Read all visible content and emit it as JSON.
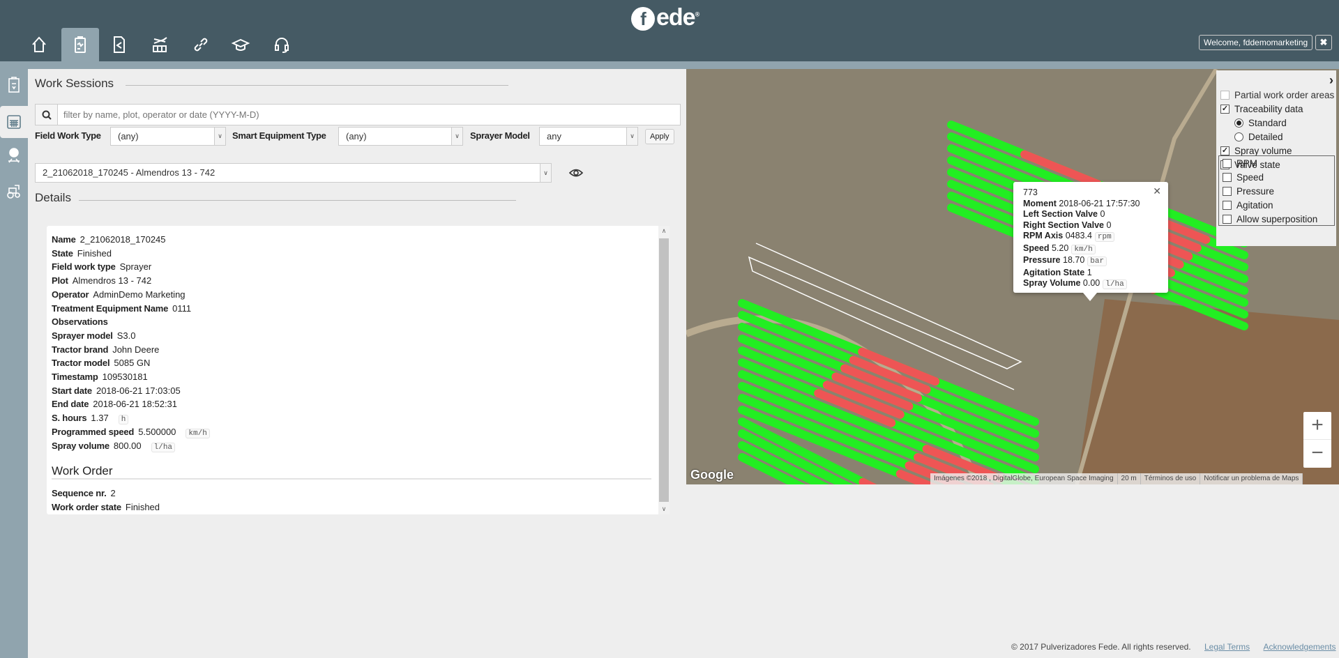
{
  "header": {
    "logo": "fede",
    "welcome": "Welcome, fddemomarketing",
    "logout_icon": "close-icon",
    "nav_icons": [
      "home-icon",
      "clipboard-icon",
      "document-share-icon",
      "sprayer-icon",
      "link-icon",
      "graduation-cap-icon",
      "headset-icon"
    ],
    "active_nav": 1
  },
  "sidebar": {
    "icons": [
      "clipboard-list-icon",
      "calendar-icon",
      "alert-sprayer-icon",
      "tractor-icon"
    ],
    "active": 1
  },
  "work_sessions": {
    "title": "Work Sessions",
    "filter_placeholder": "filter by name, plot, operator or date (YYYY-M-D)",
    "filters": [
      {
        "label": "Field Work Type",
        "value": "(any)"
      },
      {
        "label": "Smart Equipment Type",
        "value": "(any)"
      },
      {
        "label": "Sprayer Model",
        "value": "any"
      }
    ],
    "apply": "Apply",
    "session": "2_21062018_170245 - Almendros 13 - 742"
  },
  "details": {
    "title": "Details",
    "rows": [
      {
        "label": "Name",
        "value": "2_21062018_170245"
      },
      {
        "label": "State",
        "value": "Finished"
      },
      {
        "label": "Field work type",
        "value": "Sprayer"
      },
      {
        "label": "Plot",
        "value": "Almendros 13 - 742"
      },
      {
        "label": "Operator",
        "value": "AdminDemo Marketing"
      },
      {
        "label": "Treatment Equipment Name",
        "value": "0111"
      },
      {
        "label": "Observations",
        "value": ""
      },
      {
        "label": "Sprayer model",
        "value": "S3.0"
      },
      {
        "label": "Tractor brand",
        "value": "John Deere"
      },
      {
        "label": "Tractor model",
        "value": "5085 GN"
      },
      {
        "label": "Timestamp",
        "value": "109530181"
      },
      {
        "label": "Start date",
        "value": "2018-06-21 17:03:05"
      },
      {
        "label": "End date",
        "value": "2018-06-21 18:52:31"
      },
      {
        "label": "S. hours",
        "value": "1.37",
        "unit": "h"
      },
      {
        "label": "Programmed speed",
        "value": "5.500000",
        "unit": "km/h"
      },
      {
        "label": "Spray volume",
        "value": "800.00",
        "unit": "l/ha"
      }
    ],
    "work_order_title": "Work Order",
    "work_order_rows": [
      {
        "label": "Sequence nr.",
        "value": "2"
      },
      {
        "label": "Work order state",
        "value": "Finished"
      }
    ]
  },
  "map": {
    "colors": {
      "applied": "#22ee22",
      "not_applied": "#ee5555"
    },
    "popup": {
      "id": "773",
      "rows": [
        {
          "label": "Moment",
          "value": "2018-06-21 17:57:30"
        },
        {
          "label": "Left Section Valve",
          "value": "0"
        },
        {
          "label": "Right Section Valve",
          "value": "0"
        },
        {
          "label": "RPM Axis",
          "value": "0483.4",
          "unit": "rpm"
        },
        {
          "label": "Speed",
          "value": "5.20",
          "unit": "km/h"
        },
        {
          "label": "Pressure",
          "value": "18.70",
          "unit": "bar"
        },
        {
          "label": "Agitation State",
          "value": "1"
        },
        {
          "label": "Spray Volume",
          "value": "0.00",
          "unit": "l/ha"
        }
      ]
    },
    "layers": {
      "partial": {
        "label": "Partial work order areas",
        "checked": false,
        "disabled": true
      },
      "traceability": {
        "label": "Traceability data",
        "checked": true
      },
      "standard": {
        "label": "Standard",
        "selected": true
      },
      "detailed": {
        "label": "Detailed",
        "selected": false
      },
      "spray_volume": {
        "label": "Spray volume",
        "checked": true
      },
      "valve_state": {
        "label": "Valve state",
        "checked": false
      },
      "sub": [
        {
          "label": "RPM",
          "checked": false
        },
        {
          "label": "Speed",
          "checked": false
        },
        {
          "label": "Pressure",
          "checked": false
        },
        {
          "label": "Agitation",
          "checked": false
        },
        {
          "label": "Allow superposition",
          "checked": false
        }
      ]
    },
    "zoom_in": "+",
    "zoom_out": "−",
    "google": "Google",
    "attribution": [
      "Imágenes ©2018 , DigitalGlobe, European Space Imaging",
      "20 m",
      "Términos de uso",
      "Notificar un problema de Maps"
    ]
  },
  "footer": {
    "copyright": "© 2017 Pulverizadores Fede. All rights reserved.",
    "legal": "Legal Terms",
    "ack": "Acknowledgements"
  }
}
